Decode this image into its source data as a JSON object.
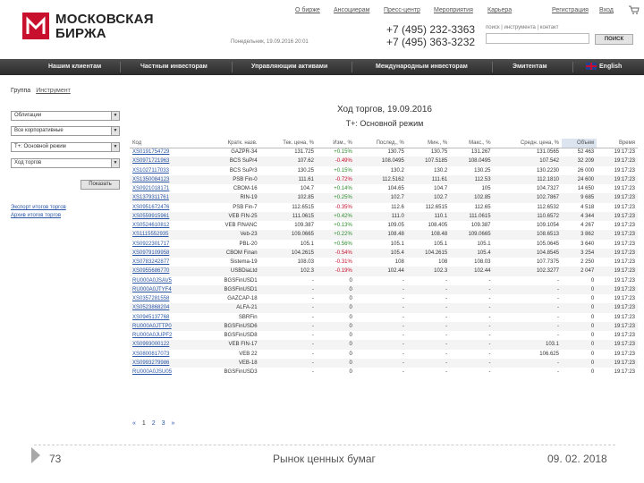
{
  "header": {
    "logo_line1": "МОСКОВСКАЯ",
    "logo_line2": "БИРЖА",
    "top_links": [
      "О бирже",
      "Ансоциерам",
      "Пресс-центр",
      "Мероприятия",
      "Карьера",
      "Регистрация",
      "Вход"
    ],
    "phone1": "+7 (495) 232-3363",
    "phone2": "+7 (495) 363-3232",
    "date_line": "Понедельник, 19.09.2016 20:01",
    "search_links": "поиск | инструмента | контакт",
    "search_value": "",
    "search_button": "ПОИСК"
  },
  "navbar": {
    "items": [
      "Нашим клиентам",
      "Частным инвесторам",
      "Управляющим активами",
      "Международным инвесторам",
      "Эмитентам",
      "English"
    ]
  },
  "left_panel": {
    "tab_active": "Группа",
    "tab_inactive": "Инструмент",
    "selects": [
      "Облигации",
      "Все корпоративные",
      "Т+: Основной режим",
      "Ход торгов"
    ],
    "show_button": "Показать",
    "links": [
      "Экспорт итогов торгов",
      "Архив итогов торгов"
    ]
  },
  "table": {
    "title": "Ход торгов, 19.09.2016",
    "subtitle": "Т+: Основной режим",
    "headers": [
      "Код",
      "Кратк. назв.",
      "Тек. цена, %",
      "Изм., %",
      "Послед., %",
      "Мин., %",
      "Макс., %",
      "Средн. цена, %",
      "Объем",
      "Время"
    ],
    "rows": [
      [
        "XS0191754729",
        "GAZPR-34",
        "131.725",
        "+0.15%",
        "130.75",
        "130.75",
        "131.267",
        "131.0565",
        "52 463",
        "19:17:23"
      ],
      [
        "XS0971721963",
        "BCS SuPr4",
        "107.62",
        "-0.49%",
        "108.0495",
        "107.5185",
        "108.0495",
        "107.542",
        "32 209",
        "19:17:23"
      ],
      [
        "XS1027117033",
        "BCS SuPr3",
        "130.25",
        "+0.15%",
        "130.2",
        "130.2",
        "130.25",
        "130.2230",
        "26 000",
        "19:17:23"
      ],
      [
        "XS1350084123",
        "PSB Fin-0",
        "111.61",
        "-0.72%",
        "112.5162",
        "111.61",
        "112.53",
        "112.1810",
        "24 600",
        "19:17:23"
      ],
      [
        "XS0921018171",
        "CBOM-16",
        "104.7",
        "+0.14%",
        "104.65",
        "104.7",
        "105",
        "104.7327",
        "14 650",
        "19:17:23"
      ],
      [
        "XS1379311761",
        "RIN-19",
        "102.85",
        "+0.25%",
        "102.7",
        "102.7",
        "102.85",
        "102.7867",
        "9 685",
        "19:17:23"
      ],
      [
        "XS0951672476",
        "PSB Fin-7",
        "112.6515",
        "-0.35%",
        "112.6",
        "112.6515",
        "112.65",
        "112.6532",
        "4 518",
        "19:17:23"
      ],
      [
        "XS0559915961",
        "VEB FIN-25",
        "111.0615",
        "+0.42%",
        "111.0",
        "110.1",
        "111.0615",
        "110.6572",
        "4 344",
        "19:17:23"
      ],
      [
        "XS0524610812",
        "VEB FINANC",
        "109.387",
        "+0.13%",
        "109.05",
        "108.405",
        "109.387",
        "109.1054",
        "4 267",
        "19:17:23"
      ],
      [
        "XS1115552935",
        "Veb-23",
        "109.0665",
        "+0.22%",
        "108.48",
        "108.48",
        "109.0665",
        "108.6513",
        "3 862",
        "19:17:23"
      ],
      [
        "XS0922301717",
        "PBL-20",
        "105.1",
        "+0.56%",
        "105.1",
        "105.1",
        "105.1",
        "105.0645",
        "3 640",
        "19:17:23"
      ],
      [
        "XS0979109958",
        "CBOM Finan",
        "104.2615",
        "-0.54%",
        "105.4",
        "104.2615",
        "105.4",
        "104.8545",
        "3 254",
        "19:17:23"
      ],
      [
        "XS0783242877",
        "Sistema-19",
        "108.03",
        "-0.31%",
        "108",
        "108",
        "108.03",
        "107.7375",
        "2 250",
        "19:17:23"
      ],
      [
        "XS0955686770",
        "USBDiaLtd",
        "102.3",
        "-0.19%",
        "102.44",
        "102.3",
        "102.44",
        "102.3277",
        "2 047",
        "19:17:23"
      ],
      [
        "RU000A0JSAV5",
        "BGSFinUSD1",
        "-",
        "0",
        "-",
        "-",
        "-",
        "-",
        "0",
        "19:17:23"
      ],
      [
        "RU000A0JTYF4",
        "BGSFinUSD1",
        "-",
        "0",
        "-",
        "-",
        "-",
        "-",
        "0",
        "19:17:23"
      ],
      [
        "XS0357281558",
        "GAZCAP-18",
        "-",
        "0",
        "-",
        "-",
        "-",
        "-",
        "0",
        "19:17:23"
      ],
      [
        "XS0523868204",
        "ALFA-21",
        "-",
        "0",
        "-",
        "-",
        "-",
        "-",
        "0",
        "19:17:23"
      ],
      [
        "XS0945137768",
        "SBRFin",
        "-",
        "0",
        "-",
        "-",
        "-",
        "-",
        "0",
        "19:17:23"
      ],
      [
        "RU000A0JTTP0",
        "BGSFinUSD6",
        "-",
        "0",
        "-",
        "-",
        "-",
        "-",
        "0",
        "19:17:23"
      ],
      [
        "RU000A0JUPF2",
        "BGSFinUSD8",
        "-",
        "0",
        "-",
        "-",
        "-",
        "-",
        "0",
        "19:17:23"
      ],
      [
        "XS0993000122",
        "VEB FIN-17",
        "-",
        "0",
        "-",
        "-",
        "-",
        "103.1",
        "0",
        "19:17:23"
      ],
      [
        "XS0800817073",
        "VEB 22",
        "-",
        "0",
        "-",
        "-",
        "-",
        "106.625",
        "0",
        "19:17:23"
      ],
      [
        "XS0993279986",
        "VEB-18",
        "-",
        "0",
        "-",
        "-",
        "-",
        "-",
        "0",
        "19:17:23"
      ],
      [
        "RU000A0JSU05",
        "BGSFinUSD3",
        "-",
        "0",
        "-",
        "-",
        "-",
        "-",
        "0",
        "19:17:23"
      ]
    ]
  },
  "pager": {
    "items": [
      "«",
      "1",
      "2",
      "3",
      "»"
    ],
    "current": "1"
  },
  "footer": {
    "slide_number": "73",
    "slide_title": "Рынок ценных бумаг",
    "slide_date": "09. 02. 2018"
  }
}
